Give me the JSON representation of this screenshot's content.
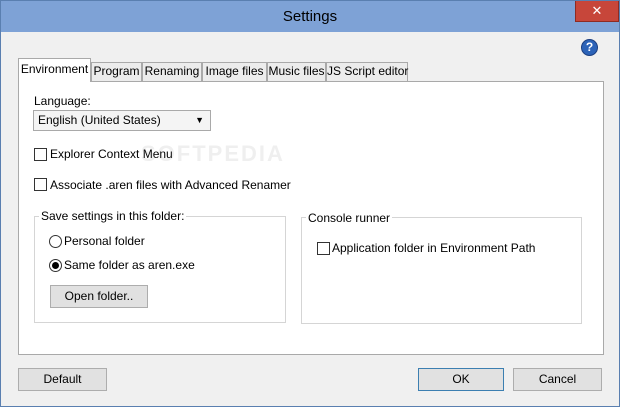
{
  "window": {
    "title": "Settings",
    "close_glyph": "✕",
    "help_glyph": "?"
  },
  "tabs": [
    {
      "label": "Environment",
      "active": true
    },
    {
      "label": "Program",
      "active": false
    },
    {
      "label": "Renaming",
      "active": false
    },
    {
      "label": "Image files",
      "active": false
    },
    {
      "label": "Music files",
      "active": false
    },
    {
      "label": "JS Script editor",
      "active": false
    }
  ],
  "environment": {
    "language_label": "Language:",
    "language_value": "English (United States)",
    "explorer_context_menu": {
      "label": "Explorer Context Menu",
      "checked": false
    },
    "associate_files": {
      "label": "Associate .aren files with Advanced Renamer",
      "checked": false
    },
    "save_settings": {
      "title": "Save settings in this folder:",
      "options": [
        {
          "label": "Personal folder",
          "selected": false
        },
        {
          "label": "Same folder as aren.exe",
          "selected": true
        }
      ],
      "open_folder_label": "Open folder.."
    },
    "console_runner": {
      "title": "Console runner",
      "app_folder_path": {
        "label": "Application folder in Environment Path",
        "checked": false
      }
    }
  },
  "footer": {
    "default_label": "Default",
    "ok_label": "OK",
    "cancel_label": "Cancel"
  },
  "watermark": "SOFTPEDIA",
  "colors": {
    "titlebar": "#7ea2d6",
    "close": "#c7463a",
    "help": "#2c63b8"
  }
}
